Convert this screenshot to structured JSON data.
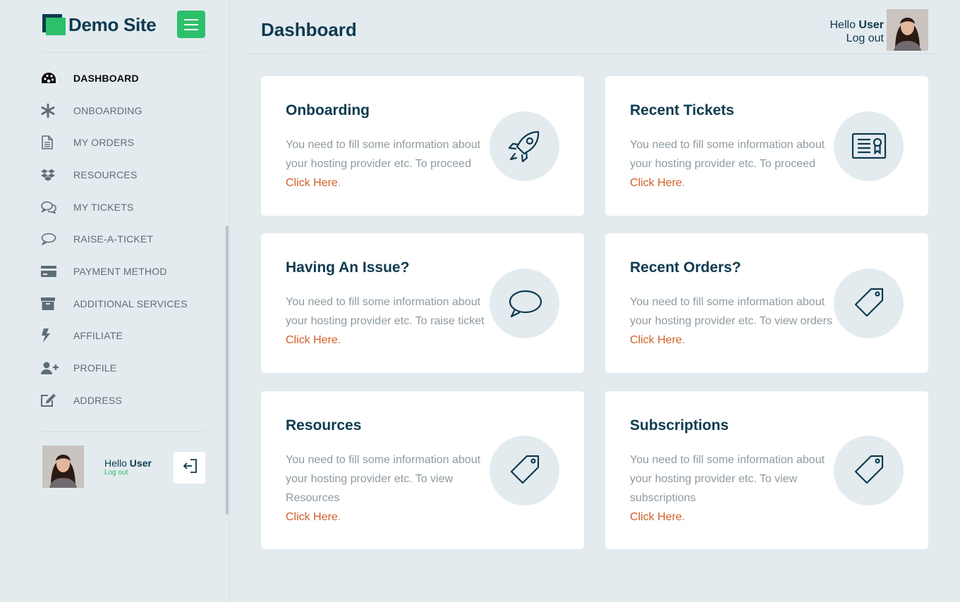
{
  "brand": {
    "name": "Demo Site",
    "accent": "#2dc06a",
    "dark": "#0e3a4f"
  },
  "sidebar": {
    "items": [
      {
        "label": "DASHBOARD",
        "icon": "dashboard-icon",
        "active": true
      },
      {
        "label": "ONBOARDING",
        "icon": "asterisk-icon"
      },
      {
        "label": "MY ORDERS",
        "icon": "document-icon"
      },
      {
        "label": "RESOURCES",
        "icon": "dropbox-icon"
      },
      {
        "label": "MY TICKETS",
        "icon": "chat-bubbles-icon"
      },
      {
        "label": "RAISE-A-TICKET",
        "icon": "chat-bubble-icon"
      },
      {
        "label": "PAYMENT METHOD",
        "icon": "credit-card-icon"
      },
      {
        "label": "ADDITIONAL SERVICES",
        "icon": "archive-box-icon"
      },
      {
        "label": "AFFILIATE",
        "icon": "lightning-bolt-icon"
      },
      {
        "label": "PROFILE",
        "icon": "user-plus-icon"
      },
      {
        "label": "ADDRESS",
        "icon": "edit-icon"
      }
    ],
    "user": {
      "greeting": "Hello",
      "name": "User",
      "logout": "Log out"
    }
  },
  "header": {
    "title": "Dashboard",
    "greeting": "Hello",
    "name": "User",
    "logout": "Log out"
  },
  "cards": [
    {
      "title": "Onboarding",
      "desc": "You need to fill some information about your hosting provider etc. To proceed",
      "link": "Click Here",
      "icon": "rocket-icon"
    },
    {
      "title": "Recent Tickets",
      "desc": "You need to fill some information about your hosting provider etc. To proceed",
      "link": "Click Here",
      "icon": "certificate-icon"
    },
    {
      "title": "Having An Issue?",
      "desc": "You need to fill some information about your hosting provider etc. To raise ticket",
      "link": "Click Here",
      "icon": "chat-bubble-icon"
    },
    {
      "title": "Recent Orders?",
      "desc": "You need to fill some information about your hosting provider etc. To view orders",
      "link": "Click Here",
      "icon": "tag-icon"
    },
    {
      "title": "Resources",
      "desc": "You need to fill some information about your hosting provider etc. To view Resources",
      "link": "Click Here",
      "icon": "tag-icon"
    },
    {
      "title": "Subscriptions",
      "desc": "You need to fill some information about your hosting provider etc. To view subscriptions",
      "link": "Click Here",
      "icon": "tag-icon"
    }
  ]
}
